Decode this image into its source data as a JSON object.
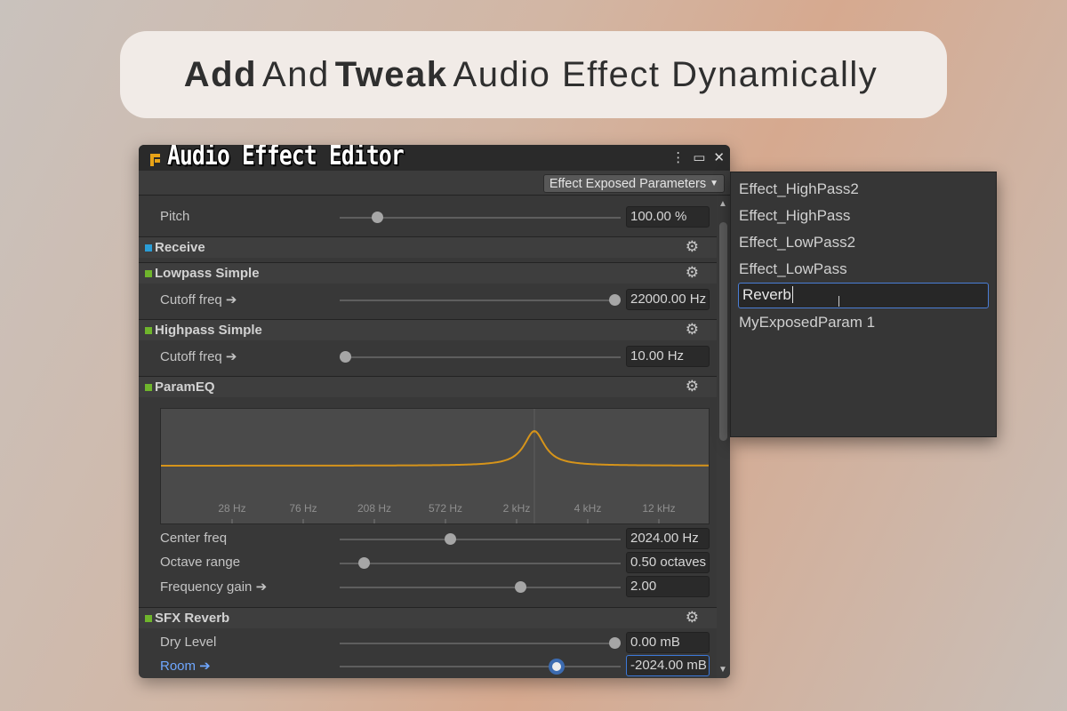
{
  "banner": {
    "word1": "Add",
    "word2": "And",
    "word3": "Tweak",
    "word4": "Audio Effect Dynamically"
  },
  "window": {
    "title": "Audio Effect Editor",
    "dropdown_label": "Effect Exposed Parameters"
  },
  "pitch": {
    "label": "Pitch",
    "value": "100.00 %",
    "slider_fraction": 0.12
  },
  "receive": {
    "title": "Receive",
    "marker_color": "#2a9dd6"
  },
  "lowpass": {
    "title": "Lowpass Simple",
    "marker_color": "#6fb52c",
    "cutoff_label": "Cutoff freq ➔",
    "cutoff_value": "22000.00 Hz",
    "slider_fraction": 1.0
  },
  "highpass": {
    "title": "Highpass Simple",
    "marker_color": "#6fb52c",
    "cutoff_label": "Cutoff freq ➔",
    "cutoff_value": "10.00 Hz",
    "slider_fraction": 0.0
  },
  "parameq": {
    "title": "ParamEQ",
    "marker_color": "#6fb52c",
    "freq_labels": [
      "28 Hz",
      "76 Hz",
      "208 Hz",
      "572 Hz",
      "2 kHz",
      "4 kHz",
      "12 kHz"
    ],
    "curve_color": "#d6941a",
    "center_freq_label": "Center freq",
    "center_freq_value": "2024.00 Hz",
    "center_freq_fraction": 0.39,
    "octave_label": "Octave range",
    "octave_value": "0.50 octaves",
    "octave_fraction": 0.07,
    "gain_label": "Frequency gain ➔",
    "gain_value": "2.00",
    "gain_fraction": 0.65
  },
  "sfxreverb": {
    "title": "SFX Reverb",
    "marker_color": "#6fb52c",
    "dry_label": "Dry Level",
    "dry_value": "0.00 mB",
    "dry_fraction": 1.0,
    "room_label": "Room ➔",
    "room_value": "-2024.00 mB",
    "room_fraction": 0.79
  },
  "popup": {
    "items": [
      "Effect_HighPass2",
      "Effect_HighPass",
      "Effect_LowPass2",
      "Effect_LowPass"
    ],
    "edit_value": "Reverb",
    "last_item": "MyExposedParam 1"
  },
  "icons": {
    "logo": "logo-icon",
    "menu": "kebab-menu-icon",
    "maximize": "maximize-icon",
    "close": "close-icon",
    "gear": "gear-icon"
  }
}
